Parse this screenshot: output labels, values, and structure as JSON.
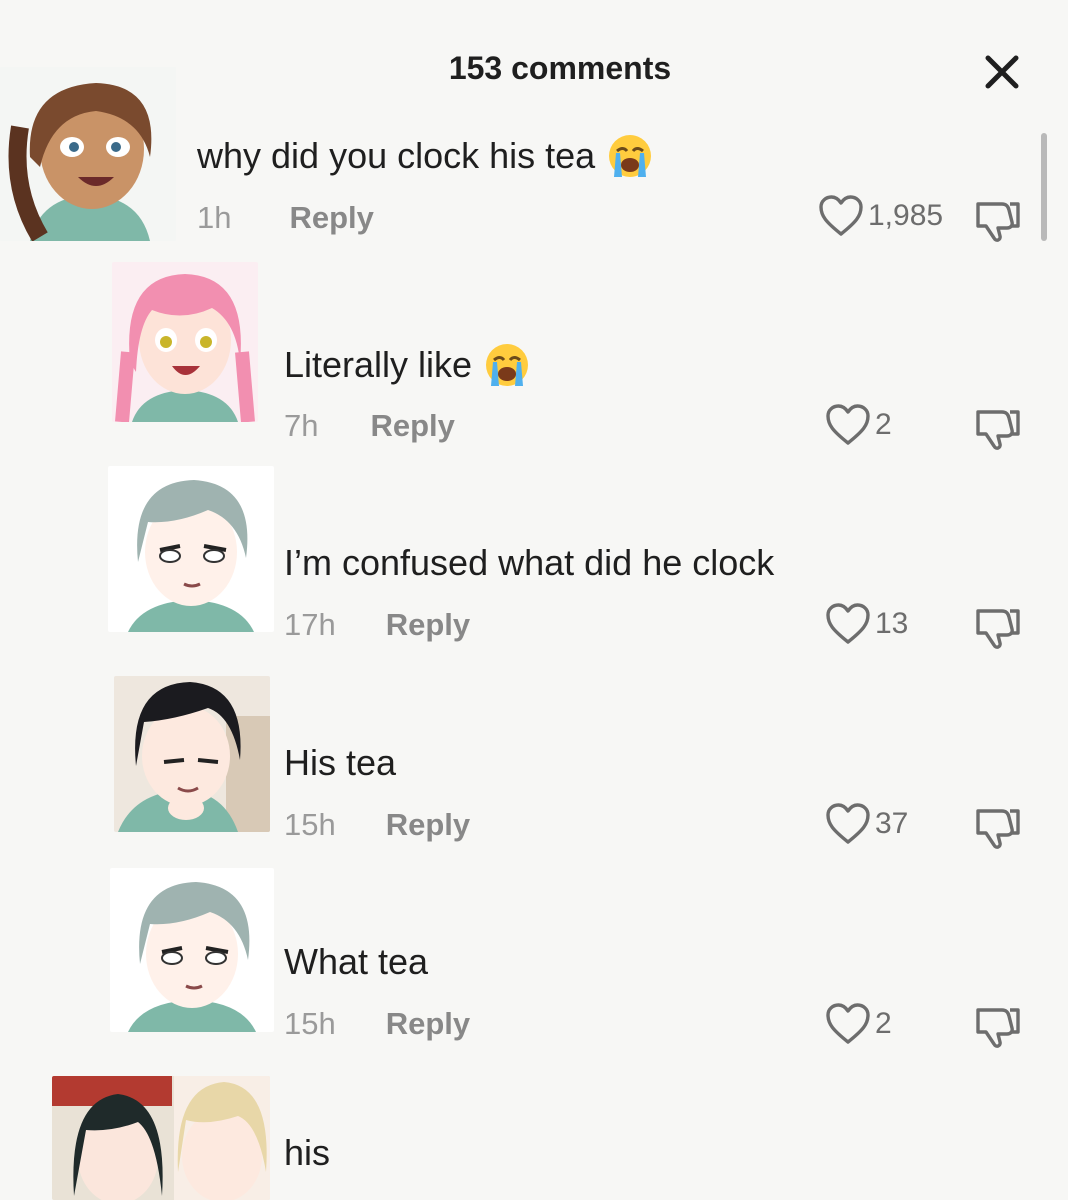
{
  "header": {
    "title": "153 comments",
    "close_icon": "close-icon"
  },
  "comments": [
    {
      "text": "why did you clock his tea",
      "emoji": "loudly-crying-face",
      "time": "1h",
      "reply_label": "Reply",
      "likes": "1,985",
      "avatar_hair": "#7a4a2e",
      "avatar_skin": "#c99367"
    },
    {
      "text": "Literally like",
      "emoji": "loudly-crying-face",
      "time": "7h",
      "reply_label": "Reply",
      "likes": "2",
      "avatar_hair": "#f28fb0",
      "avatar_skin": "#fde3d8"
    },
    {
      "text": "I’m confused what did he clock",
      "emoji": "",
      "time": "17h",
      "reply_label": "Reply",
      "likes": "13",
      "avatar_hair": "#9fb3b0",
      "avatar_skin": "#fff1ea"
    },
    {
      "text": "His tea",
      "emoji": "",
      "time": "15h",
      "reply_label": "Reply",
      "likes": "37",
      "avatar_hair": "#1b1b1f",
      "avatar_skin": "#fde9df"
    },
    {
      "text": "What tea",
      "emoji": "",
      "time": "15h",
      "reply_label": "Reply",
      "likes": "2",
      "avatar_hair": "#9fb3b0",
      "avatar_skin": "#fff1ea"
    },
    {
      "text": "his",
      "emoji": "",
      "time": "",
      "reply_label": "",
      "likes": "",
      "avatar_hair": "#1f2a2a",
      "avatar_skin": "#fbe6dc"
    }
  ],
  "icons": {
    "like": "heart-outline-icon",
    "dislike": "thumbs-down-icon"
  },
  "colors": {
    "background": "#f7f7f5",
    "text": "#1f1f1f",
    "muted": "#9a9a9a",
    "reply": "#888888"
  }
}
